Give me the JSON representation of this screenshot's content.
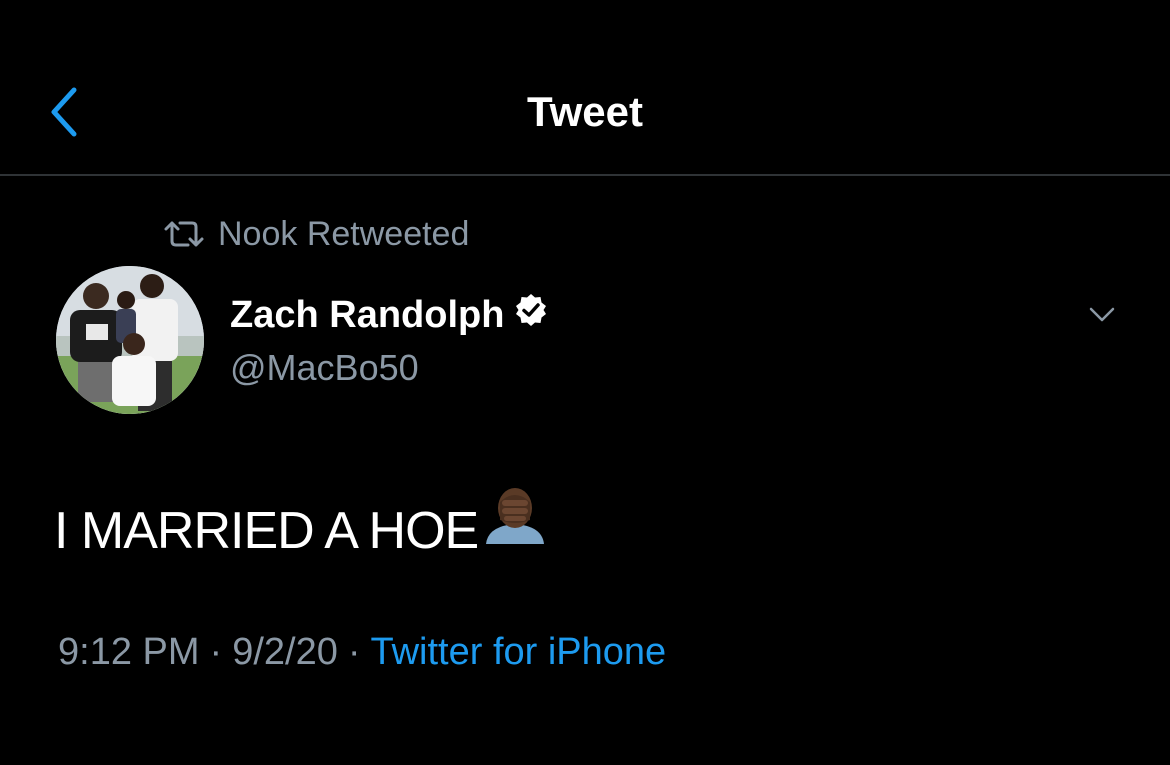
{
  "header": {
    "title": "Tweet",
    "back_icon": "chevron-left-icon"
  },
  "retweet": {
    "icon": "retweet-icon",
    "label": "Nook Retweeted"
  },
  "author": {
    "name": "Zach Randolph",
    "handle": "@MacBo50",
    "verified": true,
    "verified_icon": "verified-badge-icon",
    "avatar_icon": "avatar-photo"
  },
  "tweet": {
    "text": "I MARRIED A HOE",
    "emoji_icon": "face-palm-emoji"
  },
  "meta": {
    "time": "9:12 PM",
    "separator": "·",
    "date": "9/2/20",
    "source": "Twitter for iPhone"
  },
  "colors": {
    "background": "#000000",
    "accent_blue": "#1d9bf0",
    "secondary_text": "#8b98a5",
    "divider": "#2f3336"
  }
}
